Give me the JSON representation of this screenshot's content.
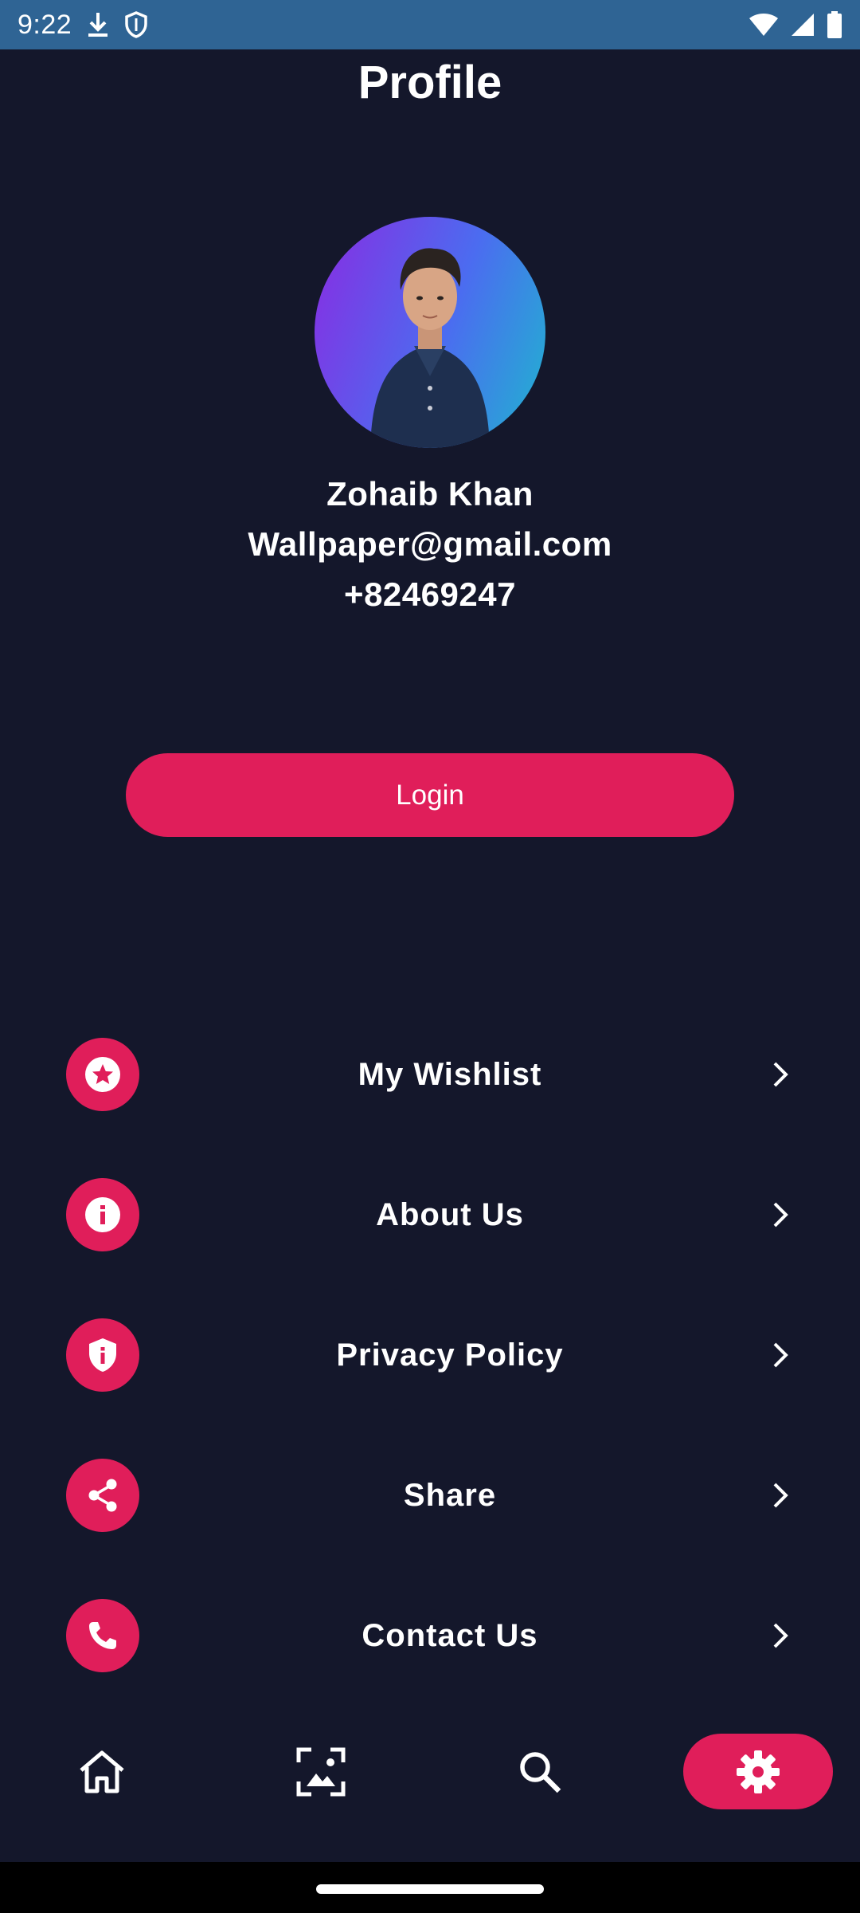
{
  "status_bar": {
    "time": "9:22",
    "icons": [
      "download-icon",
      "shield-icon",
      "wifi-icon",
      "signal-icon",
      "battery-icon"
    ]
  },
  "title": "Profile",
  "profile": {
    "name": "Zohaib Khan",
    "email": "Wallpaper@gmail.com",
    "phone": "+82469247"
  },
  "login_label": "Login",
  "menu": [
    {
      "label": "My Wishlist",
      "icon": "star-icon"
    },
    {
      "label": "About Us",
      "icon": "info-icon"
    },
    {
      "label": "Privacy Policy",
      "icon": "privacy-shield-icon"
    },
    {
      "label": "Share",
      "icon": "share-icon"
    },
    {
      "label": "Contact Us",
      "icon": "phone-icon"
    }
  ],
  "bottom_nav": [
    {
      "icon": "home-icon",
      "active": false
    },
    {
      "icon": "wallpaper-icon",
      "active": false
    },
    {
      "icon": "search-icon",
      "active": false
    },
    {
      "icon": "settings-icon",
      "active": true
    }
  ],
  "colors": {
    "background": "#14172b",
    "accent": "#e01e5a",
    "status_bar": "#2f6494"
  }
}
